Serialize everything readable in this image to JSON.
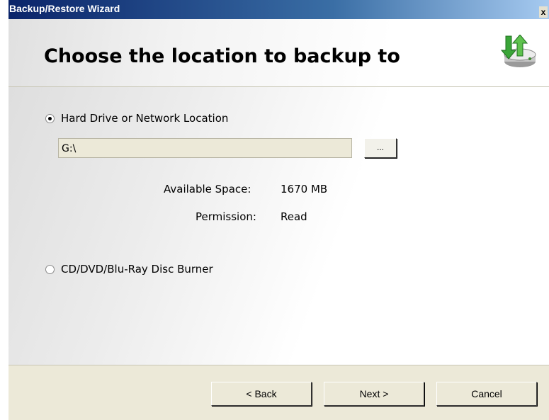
{
  "window": {
    "title": "Backup/Restore Wizard",
    "close_label": "x"
  },
  "header": {
    "title": "Choose the location to backup to",
    "icon": "backup-drive-icon"
  },
  "options": {
    "hard_drive": {
      "label": "Hard Drive or Network Location",
      "checked": true
    },
    "disc": {
      "label": "CD/DVD/Blu-Ray Disc Burner",
      "checked": false
    }
  },
  "location": {
    "path": "G:\\",
    "browse_label": "..."
  },
  "info": {
    "space_label": "Available Space:",
    "space_value": "1670 MB",
    "permission_label": "Permission:",
    "permission_value": "Read"
  },
  "buttons": {
    "back": "< Back",
    "next": "Next >",
    "cancel": "Cancel"
  },
  "colors": {
    "window_bg": "#ece9d8",
    "title_bar": "#0a246a"
  }
}
